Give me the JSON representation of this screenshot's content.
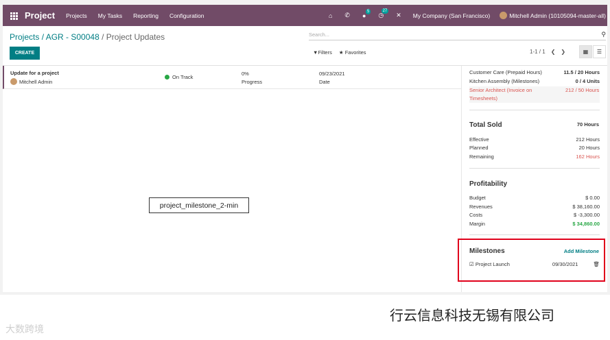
{
  "app": {
    "name": "Project"
  },
  "menu": [
    "Projects",
    "My Tasks",
    "Reporting",
    "Configuration"
  ],
  "systray": {
    "messages_badge": "5",
    "activities_badge": "27",
    "company": "My Company (San Francisco)",
    "user": "Mitchell Admin (10105094-master-all)"
  },
  "breadcrumb": {
    "root": "Projects",
    "sep1": " / ",
    "project": "AGR - S00048",
    "sep2": " / ",
    "current": "Project Updates"
  },
  "control": {
    "create_label": "CREATE",
    "search_placeholder": "Search...",
    "filters_label": "Filters",
    "favorites_label": "Favorites",
    "pager": "1-1 / 1"
  },
  "update": {
    "name": "Update for a project",
    "author": "Mitchell Admin",
    "status": "On Track",
    "progress_value": "0%",
    "progress_label": "Progress",
    "date_value": "09/23/2021",
    "date_label": "Date"
  },
  "image_label": "project_milestone_2-min",
  "panel": {
    "sold_lines": [
      {
        "name": "Customer Care (Prepaid Hours)",
        "value": "11.5 / 20 Hours"
      },
      {
        "name": "Kitchen Assembly (Milestones)",
        "value": "0 / 4 Units"
      },
      {
        "name": "Senior Architect (Invoice on Timesheets)",
        "value": "212 / 50 Hours"
      }
    ],
    "total_sold": {
      "title": "Total Sold",
      "value": "70 Hours"
    },
    "hours": [
      {
        "label": "Effective",
        "value": "212 Hours"
      },
      {
        "label": "Planned",
        "value": "20 Hours"
      },
      {
        "label": "Remaining",
        "value": "162 Hours"
      }
    ],
    "profitability": {
      "title": "Profitability",
      "rows": [
        {
          "label": "Budget",
          "value": "$ 0.00"
        },
        {
          "label": "Revenues",
          "value": "$ 38,160.00"
        },
        {
          "label": "Costs",
          "value": "$ -3,300.00"
        },
        {
          "label": "Margin",
          "value": "$ 34,860.00"
        }
      ]
    },
    "milestones": {
      "title": "Milestones",
      "add_label": "Add Milestone",
      "items": [
        {
          "name": "Project Launch",
          "date": "09/30/2021"
        }
      ]
    }
  },
  "watermark": {
    "right": "行云信息科技无锡有限公司",
    "left": "大数跨境"
  }
}
